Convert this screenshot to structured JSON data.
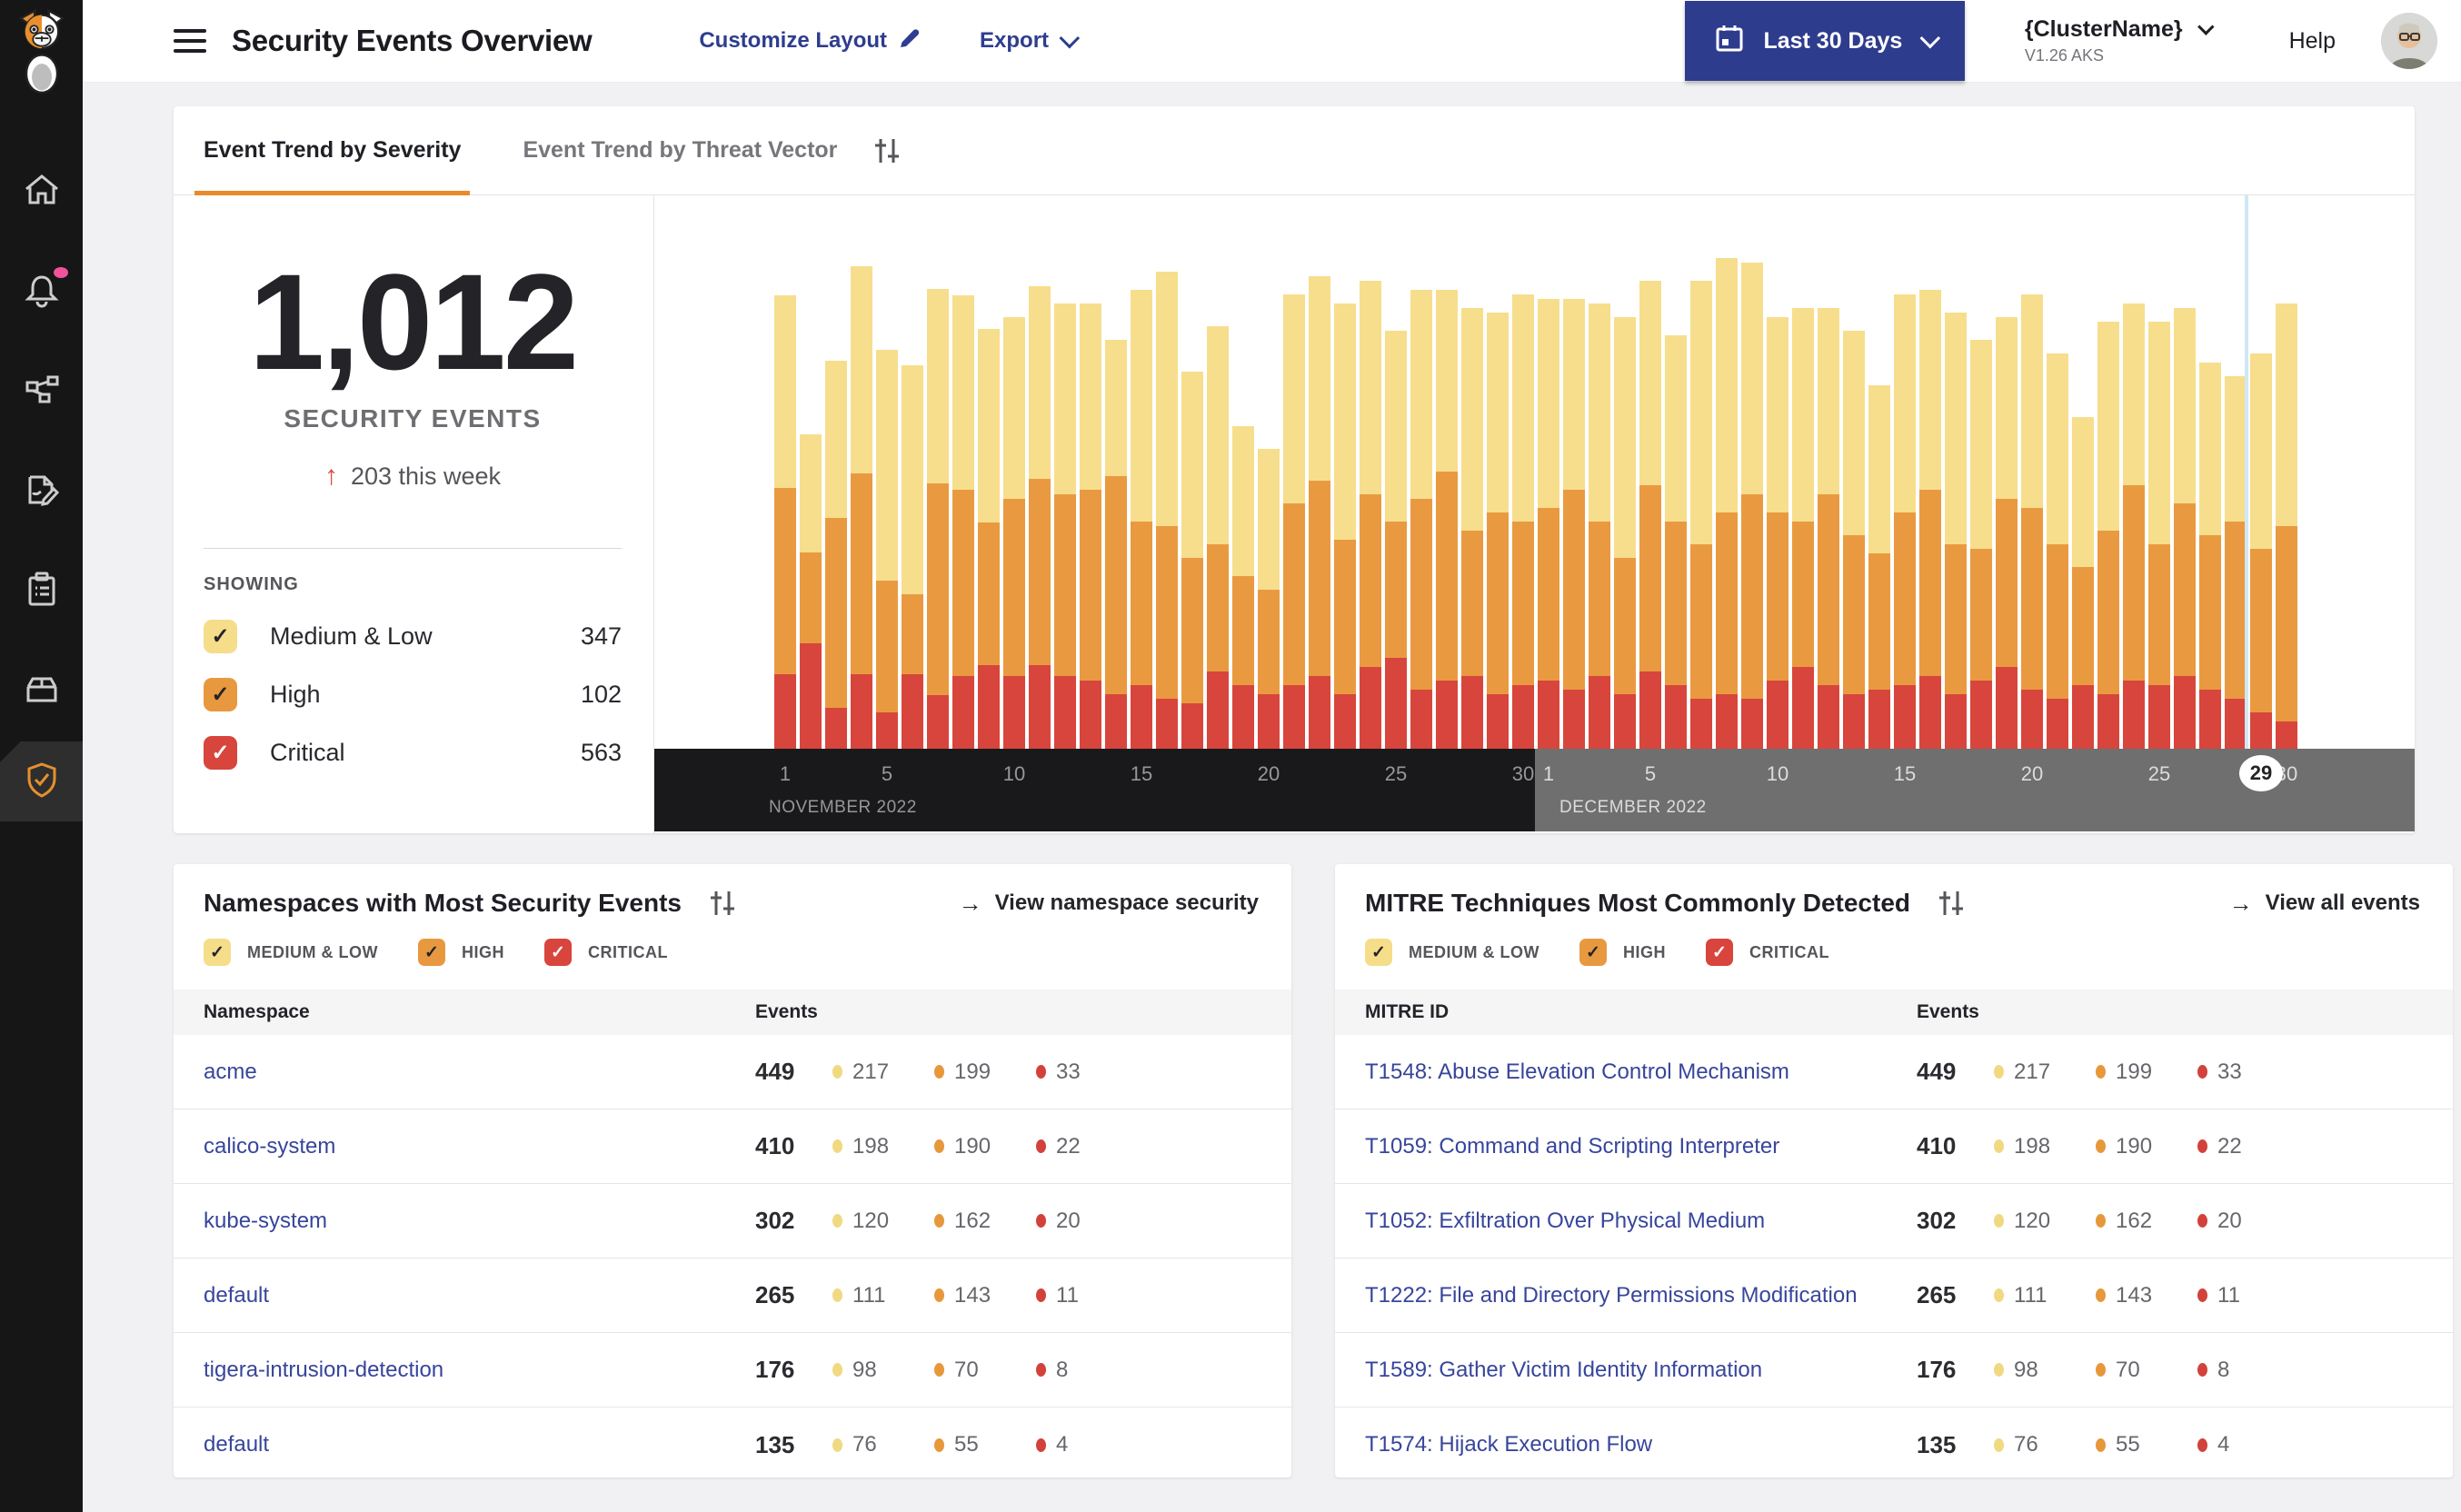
{
  "header": {
    "title": "Security Events Overview",
    "customize_label": "Customize Layout",
    "export_label": "Export",
    "date_range": "Last 30 Days",
    "cluster_name": "{ClusterName}",
    "cluster_version": "V1.26 AKS",
    "help_label": "Help"
  },
  "sidebar": {
    "icons": [
      "cat-logo",
      "home",
      "alerts",
      "service-graph",
      "policies",
      "compliance-reports",
      "workloads",
      "threat-defense"
    ],
    "active": "threat-defense"
  },
  "trend": {
    "tabs": [
      {
        "label": "Event Trend by Severity",
        "active": true
      },
      {
        "label": "Event Trend by Threat Vector",
        "active": false
      }
    ],
    "total": "1,012",
    "total_label": "SECURITY EVENTS",
    "delta_arrow": "↑",
    "delta": "203 this week",
    "showing_label": "SHOWING",
    "filters": [
      {
        "label": "Medium & Low",
        "count": "347",
        "severity": "medium"
      },
      {
        "label": "High",
        "count": "102",
        "severity": "high"
      },
      {
        "label": "Critical",
        "count": "563",
        "severity": "critical"
      }
    ]
  },
  "chart_data": {
    "type": "bar",
    "subtype": "stacked-daily-severity",
    "title": "Event Trend by Severity",
    "legend_position": "left-panel",
    "grid": false,
    "series_order": [
      "medium_low",
      "high",
      "critical"
    ],
    "colors": {
      "medium_low": "#F7DE8D",
      "high": "#E99A40",
      "critical": "#D8453C"
    },
    "unit_note": "relative stacked heights (px), order: medium_low, high, critical",
    "months": [
      {
        "label": "NOVEMBER 2022",
        "days": 30,
        "ticks": [
          1,
          5,
          10,
          15,
          20,
          25,
          30
        ]
      },
      {
        "label": "DECEMBER 2022",
        "days": 30,
        "ticks": [
          1,
          5,
          10,
          15,
          20,
          25,
          30
        ],
        "highlighted_day": 29
      }
    ],
    "selected_day_index": 58,
    "values": [
      [
        212,
        205,
        82
      ],
      [
        130,
        100,
        116
      ],
      [
        173,
        209,
        45
      ],
      [
        228,
        221,
        82
      ],
      [
        254,
        145,
        40
      ],
      [
        252,
        88,
        82
      ],
      [
        214,
        233,
        59
      ],
      [
        214,
        205,
        80
      ],
      [
        213,
        157,
        92
      ],
      [
        200,
        195,
        80
      ],
      [
        212,
        205,
        92
      ],
      [
        210,
        200,
        80
      ],
      [
        205,
        210,
        75
      ],
      [
        150,
        240,
        60
      ],
      [
        255,
        180,
        70
      ],
      [
        280,
        190,
        55
      ],
      [
        205,
        160,
        50
      ],
      [
        240,
        140,
        85
      ],
      [
        165,
        120,
        70
      ],
      [
        155,
        115,
        60
      ],
      [
        230,
        200,
        70
      ],
      [
        225,
        215,
        80
      ],
      [
        260,
        170,
        60
      ],
      [
        235,
        190,
        90
      ],
      [
        210,
        150,
        100
      ],
      [
        230,
        210,
        65
      ],
      [
        200,
        230,
        75
      ],
      [
        245,
        160,
        80
      ],
      [
        220,
        200,
        60
      ],
      [
        250,
        180,
        70
      ],
      [
        230,
        190,
        75
      ],
      [
        210,
        220,
        65
      ],
      [
        240,
        170,
        80
      ],
      [
        265,
        150,
        60
      ],
      [
        225,
        205,
        85
      ],
      [
        205,
        180,
        70
      ],
      [
        290,
        170,
        55
      ],
      [
        280,
        200,
        60
      ],
      [
        255,
        225,
        55
      ],
      [
        215,
        185,
        75
      ],
      [
        235,
        160,
        90
      ],
      [
        205,
        210,
        70
      ],
      [
        225,
        175,
        60
      ],
      [
        185,
        150,
        65
      ],
      [
        240,
        190,
        70
      ],
      [
        220,
        205,
        80
      ],
      [
        255,
        165,
        60
      ],
      [
        230,
        145,
        75
      ],
      [
        200,
        185,
        90
      ],
      [
        235,
        200,
        65
      ],
      [
        210,
        170,
        55
      ],
      [
        165,
        130,
        70
      ],
      [
        230,
        180,
        60
      ],
      [
        200,
        215,
        75
      ],
      [
        245,
        155,
        70
      ],
      [
        215,
        190,
        80
      ],
      [
        190,
        170,
        65
      ],
      [
        160,
        195,
        55
      ],
      [
        215,
        180,
        40
      ],
      [
        245,
        215,
        30
      ]
    ]
  },
  "namespaces_card": {
    "title": "Namespaces with Most Security Events",
    "link": "View namespace security",
    "link_arrow": "→",
    "filters": [
      "MEDIUM & LOW",
      "HIGH",
      "CRITICAL"
    ],
    "columns": [
      "Namespace",
      "Events"
    ],
    "rows": [
      {
        "name": "acme",
        "total": "449",
        "medium": "217",
        "high": "199",
        "critical": "33"
      },
      {
        "name": "calico-system",
        "total": "410",
        "medium": "198",
        "high": "190",
        "critical": "22"
      },
      {
        "name": "kube-system",
        "total": "302",
        "medium": "120",
        "high": "162",
        "critical": "20"
      },
      {
        "name": "default",
        "total": "265",
        "medium": "111",
        "high": "143",
        "critical": "11"
      },
      {
        "name": "tigera-intrusion-detection",
        "total": "176",
        "medium": "98",
        "high": "70",
        "critical": "8"
      },
      {
        "name": "default",
        "total": "135",
        "medium": "76",
        "high": "55",
        "critical": "4"
      }
    ]
  },
  "mitre_card": {
    "title": "MITRE Techniques Most Commonly Detected",
    "link": "View all events",
    "link_arrow": "→",
    "filters": [
      "MEDIUM & LOW",
      "HIGH",
      "CRITICAL"
    ],
    "columns": [
      "MITRE ID",
      "Events"
    ],
    "rows": [
      {
        "name": "T1548: Abuse Elevation Control Mechanism",
        "total": "449",
        "medium": "217",
        "high": "199",
        "critical": "33"
      },
      {
        "name": "T1059: Command and Scripting Interpreter",
        "total": "410",
        "medium": "198",
        "high": "190",
        "critical": "22"
      },
      {
        "name": "T1052: Exfiltration Over Physical Medium",
        "total": "302",
        "medium": "120",
        "high": "162",
        "critical": "20"
      },
      {
        "name": "T1222: File and Directory Permissions Modification",
        "total": "265",
        "medium": "111",
        "high": "143",
        "critical": "11"
      },
      {
        "name": "T1589: Gather Victim Identity Information",
        "total": "176",
        "medium": "98",
        "high": "70",
        "critical": "8"
      },
      {
        "name": "T1574: Hijack Execution Flow",
        "total": "135",
        "medium": "76",
        "high": "55",
        "critical": "4"
      }
    ]
  },
  "colors": {
    "accent_orange": "#E98A2B",
    "severity_medium": "#F7DE8D",
    "severity_high": "#E99A40",
    "severity_critical": "#D8453C",
    "indigo_link": "#2E3D8F",
    "table_link": "#37459B",
    "date_button_bg": "#2E3C8D",
    "notification_pink": "#F0539C",
    "selection_line": "#CFE8F4",
    "axis_november_bg": "#19191B",
    "axis_december_bg": "#6F6F6F"
  }
}
